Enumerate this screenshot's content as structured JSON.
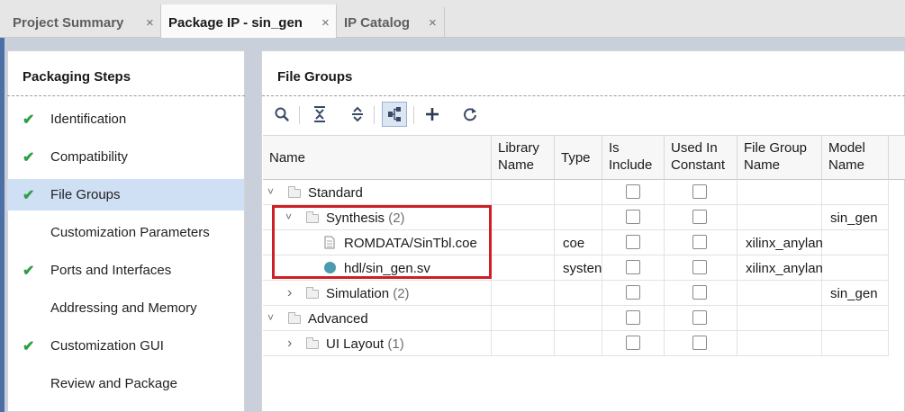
{
  "tabs": [
    {
      "label": "Project Summary",
      "active": false
    },
    {
      "label": "Package IP - sin_gen",
      "active": true
    },
    {
      "label": "IP Catalog",
      "active": false
    }
  ],
  "tab_close_glyph": "×",
  "left_panel": {
    "title": "Packaging Steps",
    "steps": [
      {
        "label": "Identification",
        "checked": true
      },
      {
        "label": "Compatibility",
        "checked": true
      },
      {
        "label": "File Groups",
        "checked": true,
        "selected": true
      },
      {
        "label": "Customization Parameters",
        "checked": false
      },
      {
        "label": "Ports and Interfaces",
        "checked": true
      },
      {
        "label": "Addressing and Memory",
        "checked": false
      },
      {
        "label": "Customization GUI",
        "checked": true
      },
      {
        "label": "Review and Package",
        "checked": false
      }
    ],
    "check_glyph": "✔"
  },
  "right_panel": {
    "title": "File Groups",
    "toolbar_icons": [
      "search-icon",
      "collapse-all-icon",
      "expand-all-icon",
      "hierarchy-icon",
      "add-icon",
      "refresh-icon"
    ],
    "columns": [
      {
        "label": "Name"
      },
      {
        "label": "Library Name"
      },
      {
        "label": "Type"
      },
      {
        "label": "Is Include"
      },
      {
        "label": "Used In Constant"
      },
      {
        "label": "File Group Name"
      },
      {
        "label": "Model Name"
      }
    ],
    "rows": [
      {
        "name": "Standard",
        "count": "",
        "kind": "folder",
        "expand": "˅",
        "type": "",
        "file_group": "",
        "model": ""
      },
      {
        "name": "Synthesis",
        "count": "(2)",
        "kind": "folder",
        "expand": "˅",
        "type": "",
        "file_group": "",
        "model": "sin_gen"
      },
      {
        "name": "ROMDATA/SinTbl.coe",
        "count": "",
        "kind": "file",
        "expand": "",
        "type": "coe",
        "file_group": "xilinx_anylan",
        "model": ""
      },
      {
        "name": "hdl/sin_gen.sv",
        "count": "",
        "kind": "source",
        "expand": "",
        "type": "systen",
        "file_group": "xilinx_anylan",
        "model": ""
      },
      {
        "name": "Simulation",
        "count": "(2)",
        "kind": "folder",
        "expand": "›",
        "type": "",
        "file_group": "",
        "model": "sin_gen"
      },
      {
        "name": "Advanced",
        "count": "",
        "kind": "folder",
        "expand": "˅",
        "type": "",
        "file_group": "",
        "model": ""
      },
      {
        "name": "UI Layout",
        "count": "(1)",
        "kind": "folder",
        "expand": "›",
        "type": "",
        "file_group": "",
        "model": ""
      }
    ]
  },
  "colors": {
    "accent_selected": "#cfe0f5",
    "check_green": "#2f9e43",
    "highlight_red": "#cc2026",
    "source_dot": "#4a9bb0"
  }
}
